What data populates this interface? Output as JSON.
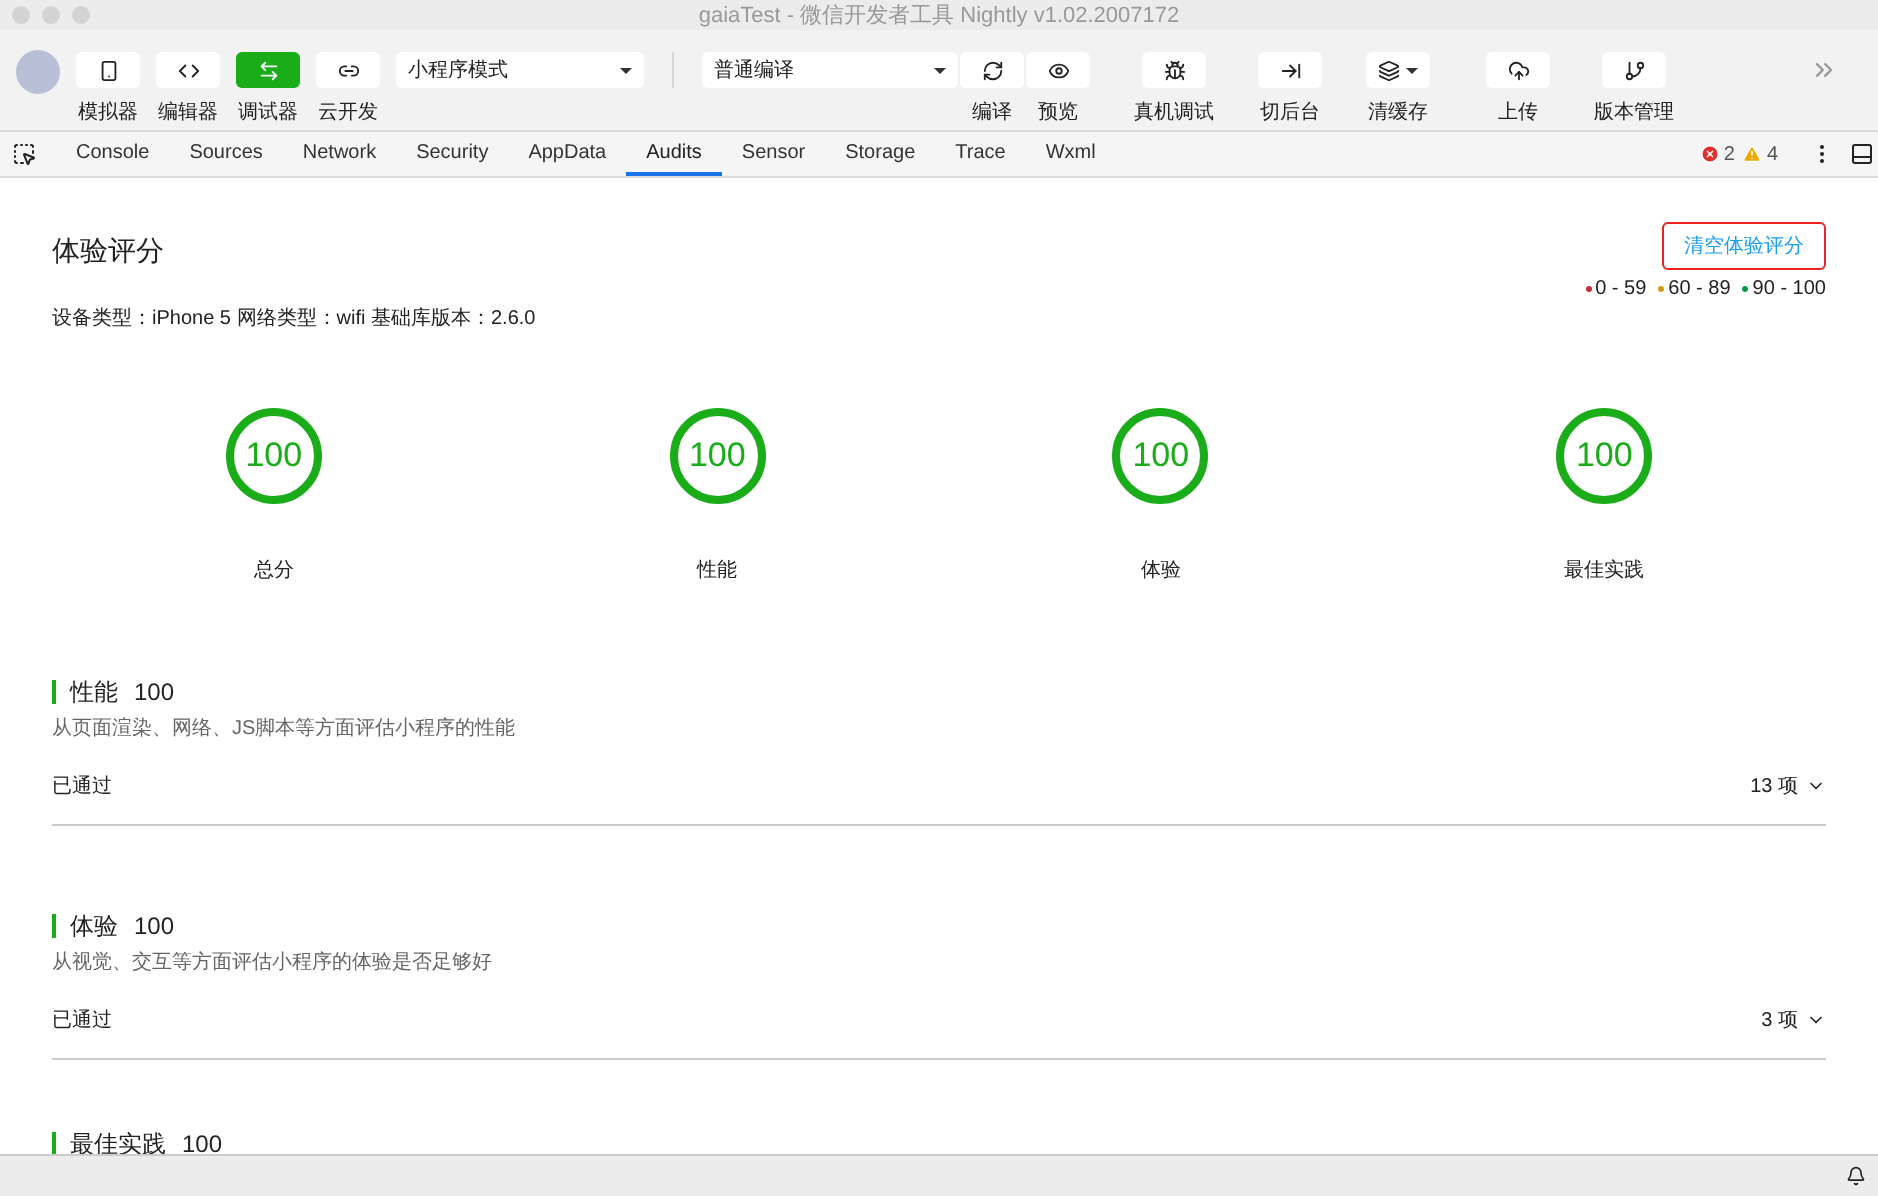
{
  "window": {
    "title": "gaiaTest - 微信开发者工具 Nightly v1.02.2007172"
  },
  "toolbar": {
    "left_buttons": [
      {
        "kind": "simulator",
        "label": "模拟器",
        "selected": false
      },
      {
        "kind": "editor",
        "label": "编辑器",
        "selected": false
      },
      {
        "kind": "debugger",
        "label": "调试器",
        "selected": true
      },
      {
        "kind": "cloud",
        "label": "云开发",
        "selected": false
      }
    ],
    "mode_select": {
      "value": "小程序模式"
    },
    "compile_select": {
      "value": "普通编译"
    },
    "compile_buttons": [
      {
        "kind": "compile",
        "label": "编译"
      },
      {
        "kind": "preview",
        "label": "预览"
      }
    ],
    "right_buttons": [
      {
        "kind": "remote-debug",
        "label": "真机调试"
      },
      {
        "kind": "background",
        "label": "切后台"
      },
      {
        "kind": "cache",
        "label": "清缓存"
      },
      {
        "kind": "upload",
        "label": "上传"
      },
      {
        "kind": "version",
        "label": "版本管理"
      }
    ]
  },
  "devtools": {
    "tabs": [
      {
        "label": "Console",
        "selected": false
      },
      {
        "label": "Sources",
        "selected": false
      },
      {
        "label": "Network",
        "selected": false
      },
      {
        "label": "Security",
        "selected": false
      },
      {
        "label": "AppData",
        "selected": false
      },
      {
        "label": "Audits",
        "selected": true
      },
      {
        "label": "Sensor",
        "selected": false
      },
      {
        "label": "Storage",
        "selected": false
      },
      {
        "label": "Trace",
        "selected": false
      },
      {
        "label": "Wxml",
        "selected": false
      }
    ],
    "errors": "2",
    "warnings": "4"
  },
  "audit": {
    "title": "体验评分",
    "clear_button": "清空体验评分",
    "legend": [
      {
        "label": "0 - 59",
        "color": "#d0283c"
      },
      {
        "label": "60 - 89",
        "color": "#d69a1c"
      },
      {
        "label": "90 - 100",
        "color": "#0c9a4a"
      }
    ],
    "info": "设备类型：iPhone 5 网络类型：wifi 基础库版本：2.6.0",
    "gauges": [
      {
        "score": "100",
        "label": "总分"
      },
      {
        "score": "100",
        "label": "性能"
      },
      {
        "score": "100",
        "label": "体验"
      },
      {
        "score": "100",
        "label": "最佳实践"
      }
    ],
    "sections": [
      {
        "title": "性能",
        "score": "100",
        "description": "从页面渲染、网络、JS脚本等方面评估小程序的性能",
        "status": "已通过",
        "count": "13 项"
      },
      {
        "title": "体验",
        "score": "100",
        "description": "从视觉、交互等方面评估小程序的体验是否足够好",
        "status": "已通过",
        "count": "3 项"
      },
      {
        "title": "最佳实践",
        "score": "100"
      }
    ]
  }
}
